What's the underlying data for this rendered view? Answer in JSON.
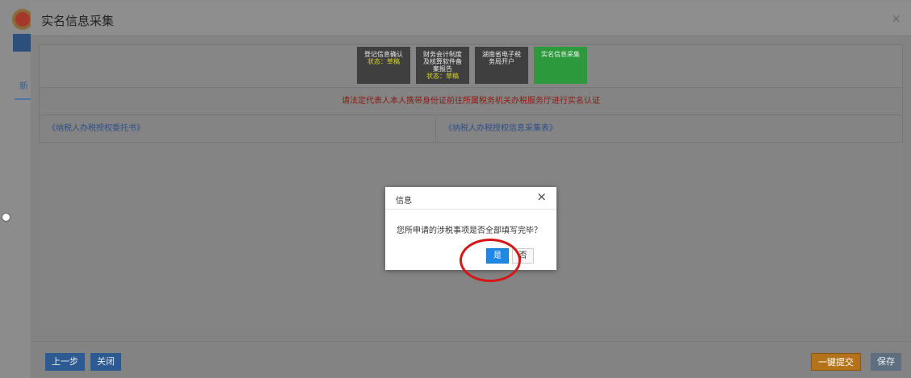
{
  "modal": {
    "title": "实名信息采集",
    "close_glyph": "×"
  },
  "steps": [
    {
      "line1": "登记信息确认",
      "line2": "",
      "line3": "",
      "status": "状态：草稿"
    },
    {
      "line1": "财务会计制度",
      "line2": "及核算软件备",
      "line3": "案报告",
      "status": "状态：草稿"
    },
    {
      "line1": "湖南省电子税",
      "line2": "务局开户",
      "line3": "",
      "status": ""
    },
    {
      "line1": "实名信息采集",
      "line2": "",
      "line3": "",
      "status": ""
    }
  ],
  "notice": "请法定代表人本人携带身份证前往所属税务机关办税服务厅进行实名认证",
  "links": {
    "left": "《纳税人办税授权委托书》",
    "right": "《纳税人办税授权信息采集表》"
  },
  "footer": {
    "prev": "上一步",
    "close": "关闭",
    "submit": "一键提交",
    "save": "保存"
  },
  "dialog": {
    "title": "信息",
    "close_glyph": "×",
    "message": "您所申请的涉税事项是否全部填写完毕？",
    "yes": "是",
    "no": "否"
  },
  "colors": {
    "primary": "#1e88e5",
    "highlight": "#d41818",
    "step_active": "#2c9a3c",
    "notice_text": "#8b1a10"
  }
}
